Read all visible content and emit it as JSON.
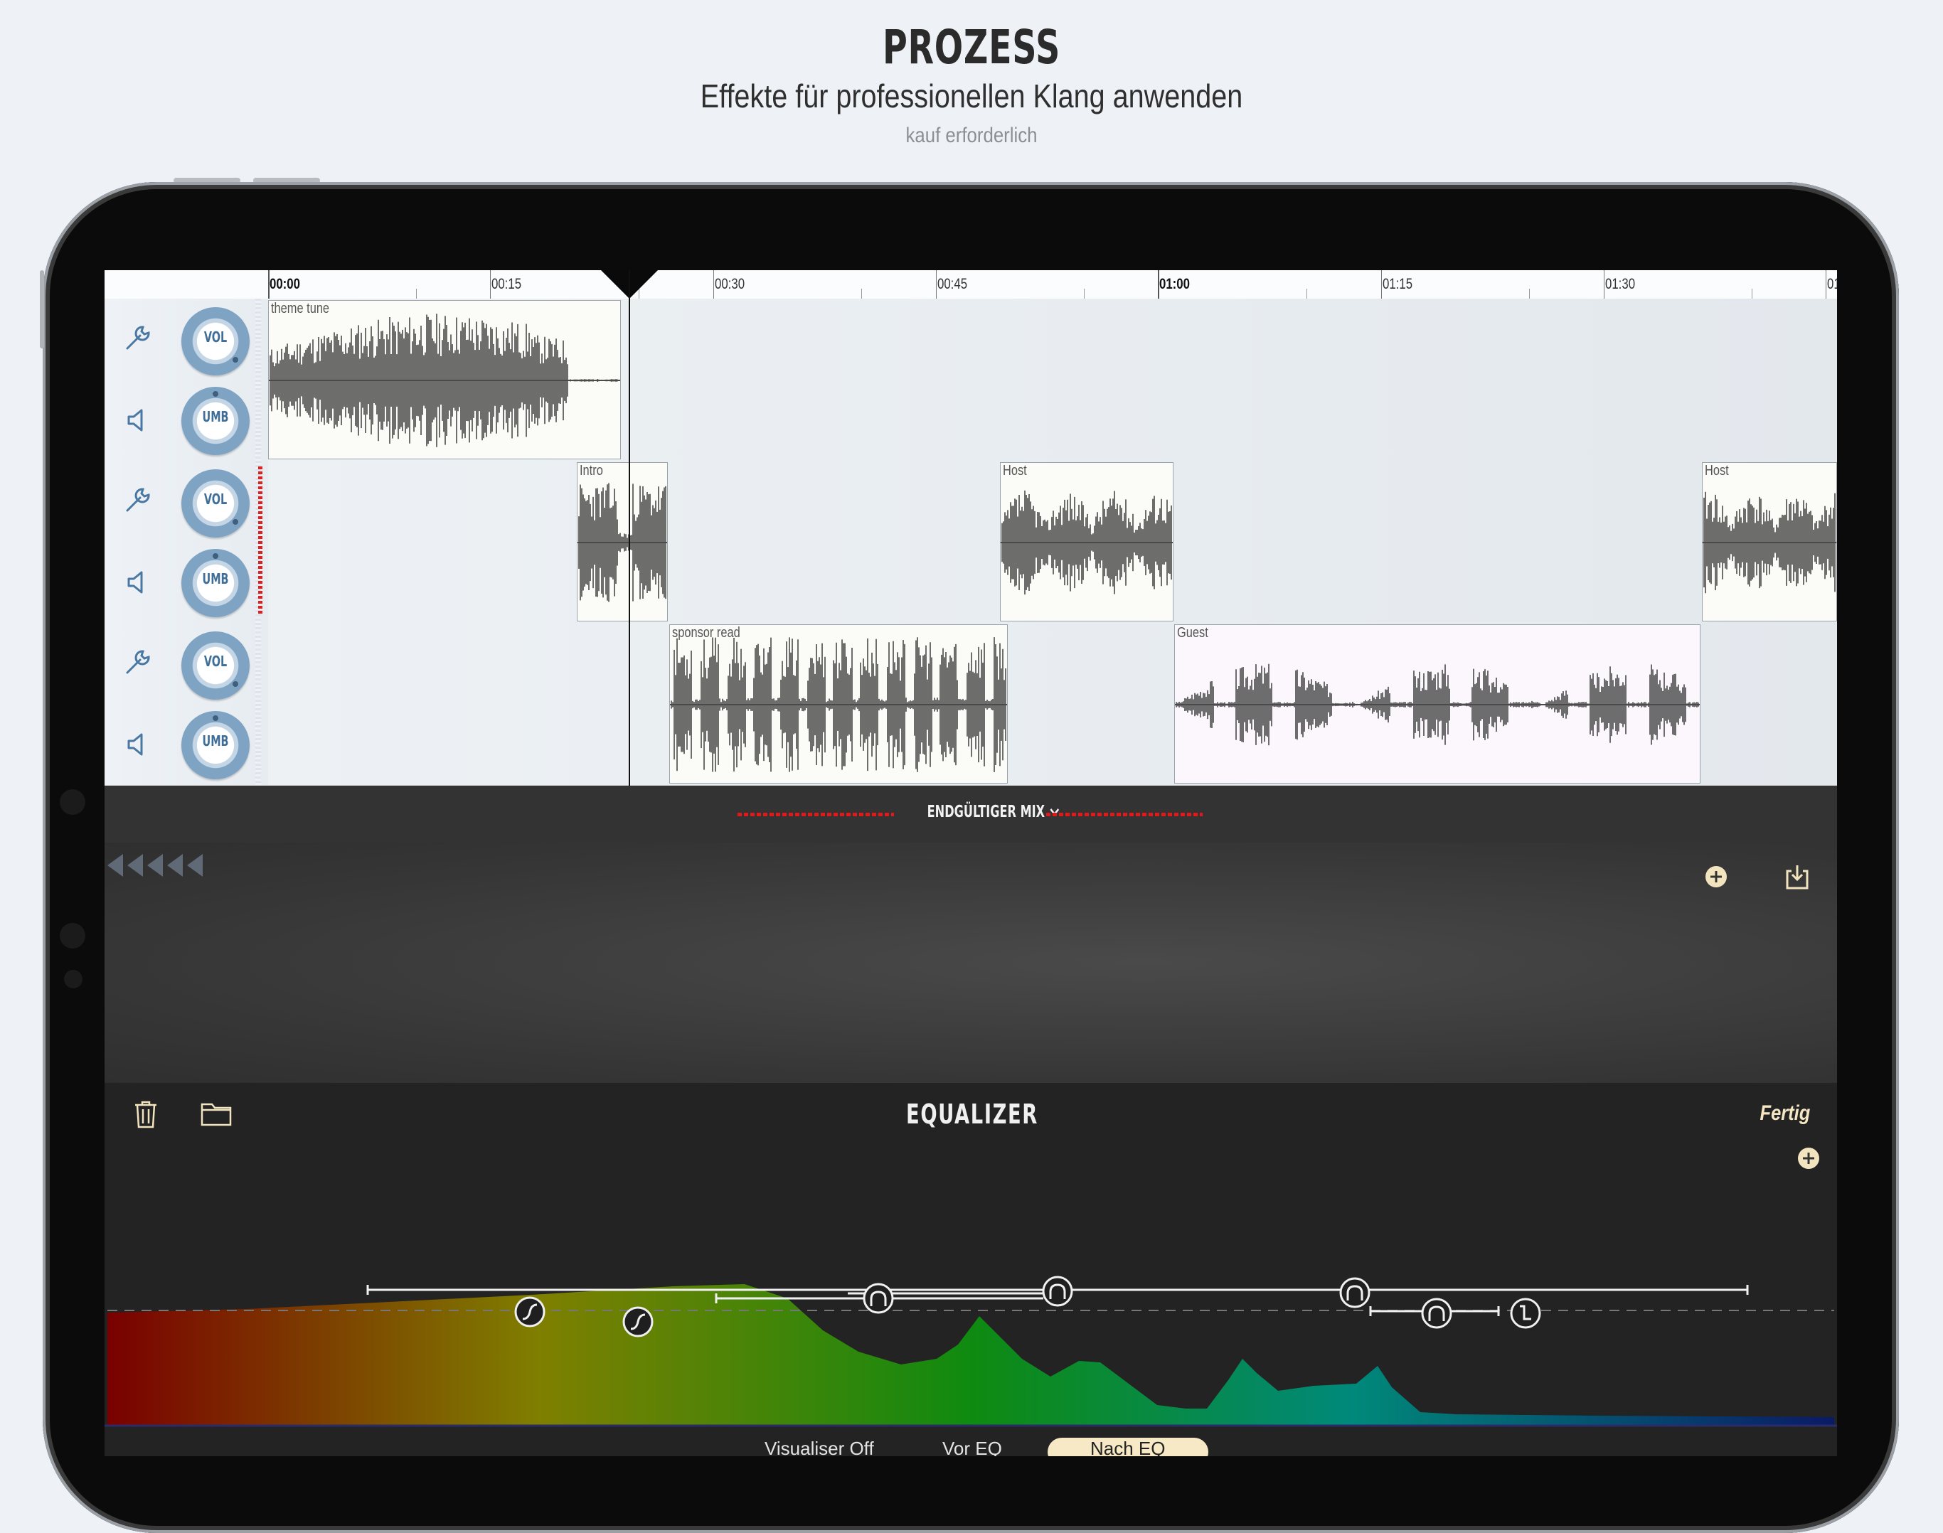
{
  "header": {
    "title": "PROZESS",
    "subtitle": "Effekte für professionellen Klang anwenden",
    "note": "kauf erforderlich"
  },
  "timeline": {
    "ticks": [
      "00:00",
      "00:15",
      "00:30",
      "00:45",
      "01:00",
      "01:15",
      "01:30",
      "01"
    ]
  },
  "tracks": [
    {
      "vol_label": "VOL",
      "pan_label": "UMB"
    },
    {
      "vol_label": "VOL",
      "pan_label": "UMB"
    },
    {
      "vol_label": "VOL",
      "pan_label": "UMB"
    }
  ],
  "clips": [
    {
      "label": "theme tune"
    },
    {
      "label": "Intro"
    },
    {
      "label": "Host"
    },
    {
      "label": "Host"
    },
    {
      "label": "sponsor read"
    },
    {
      "label": "Guest"
    }
  ],
  "mix": {
    "label": "ENDGÜLTIGER MIX"
  },
  "equalizer": {
    "title": "EQUALIZER",
    "done": "Fertig",
    "tabs": [
      "Visualiser Off",
      "Vor EQ",
      "Nach EQ"
    ],
    "selected_tab": "Nach EQ"
  },
  "colors": {
    "accent": "#f7e9c6",
    "meter_red": "#e01a1a",
    "knob_blue": "#7ea3c3"
  },
  "icons": [
    "wrench-icon",
    "speaker-icon",
    "plus-icon",
    "export-icon",
    "trash-icon",
    "folder-icon"
  ]
}
